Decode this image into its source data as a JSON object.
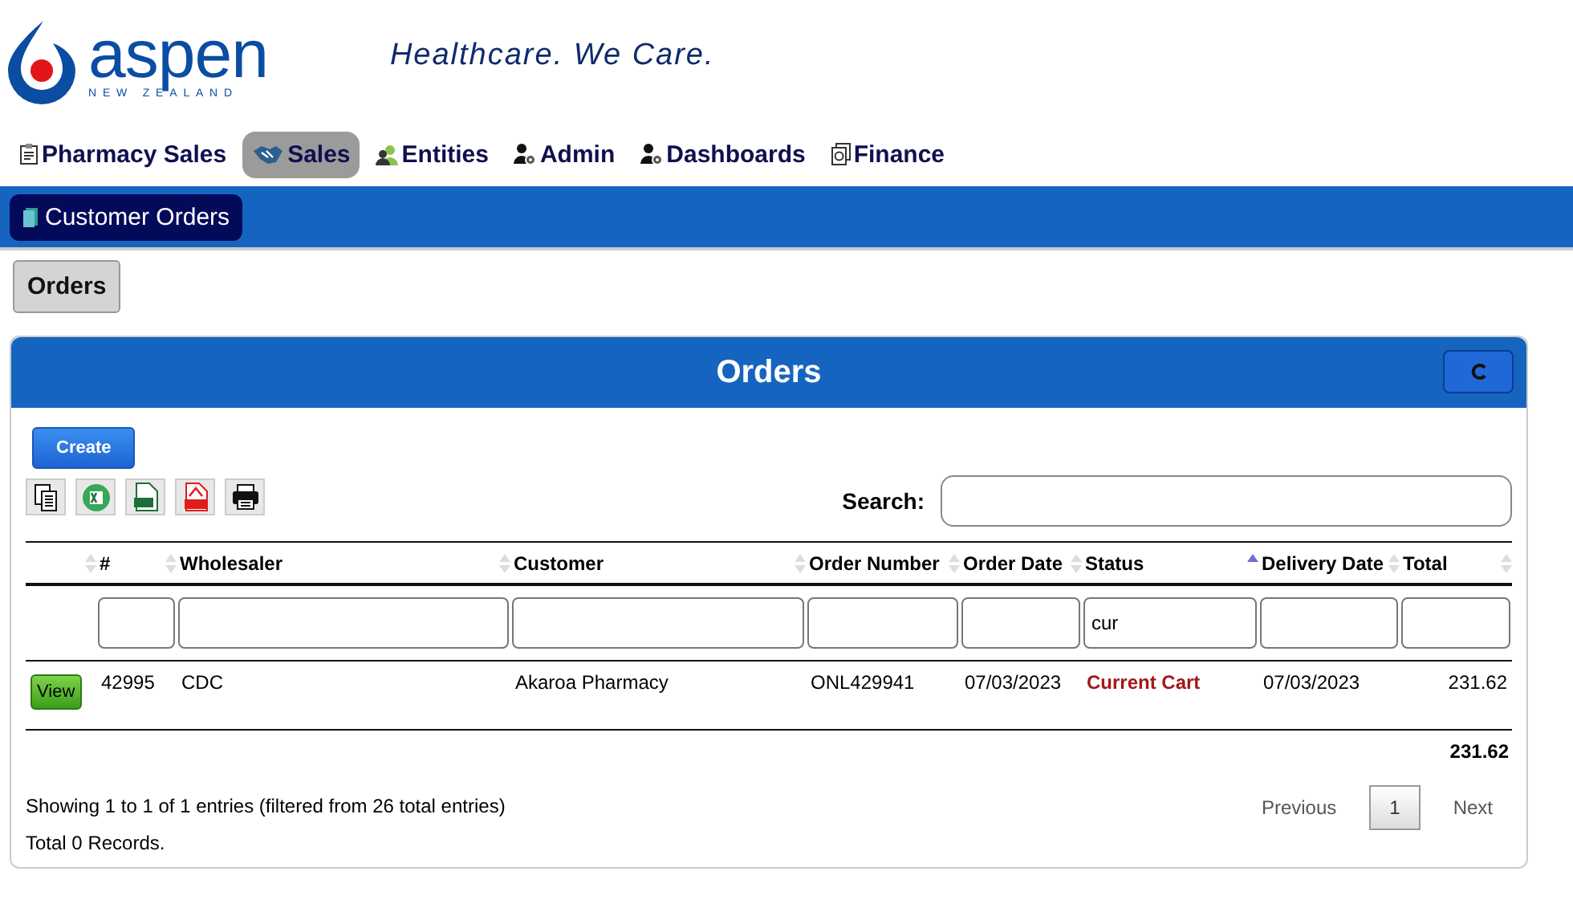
{
  "logo": {
    "wordmark": "aspen",
    "region": "NEW ZEALAND"
  },
  "tagline": "Healthcare. We Care.",
  "nav": [
    {
      "label": "Pharmacy Sales",
      "selected": false
    },
    {
      "label": "Sales",
      "selected": true
    },
    {
      "label": "Entities",
      "selected": false
    },
    {
      "label": "Admin",
      "selected": false
    },
    {
      "label": "Dashboards",
      "selected": false
    },
    {
      "label": "Finance",
      "selected": false
    }
  ],
  "subnav": [
    {
      "label": "Customer Orders",
      "selected": true
    }
  ],
  "section_button": "Orders",
  "panel": {
    "title": "Orders",
    "create_button": "Create",
    "export_buttons": [
      {
        "kind": "copy"
      },
      {
        "kind": "excel"
      },
      {
        "kind": "csv"
      },
      {
        "kind": "pdf"
      },
      {
        "kind": "print"
      }
    ],
    "search_label": "Search:",
    "table": {
      "columns": [
        {
          "sorted": false
        },
        {
          "label": "#",
          "sorted": false
        },
        {
          "label": "Wholesaler",
          "sorted": false
        },
        {
          "label": "Customer",
          "sorted": false
        },
        {
          "label": "Order Number",
          "sorted": false
        },
        {
          "label": "Order Date",
          "sorted": false
        },
        {
          "label": "Status",
          "sorted": true,
          "filter": "cur"
        },
        {
          "label": "Delivery Date",
          "sorted": false
        },
        {
          "label": "Total",
          "sorted": false
        }
      ],
      "rows": [
        {
          "cells": [
            "View",
            "42995",
            "CDC",
            "Akaroa Pharmacy",
            "ONL429941",
            "07/03/2023",
            "Current Cart",
            "07/03/2023",
            "231.62"
          ]
        }
      ],
      "footer_total": "231.62"
    },
    "info": "Showing 1 to 1 of 1 entries (filtered from 26 total entries)",
    "records": "Total 0 Records.",
    "pagination": {
      "previous": "Previous",
      "pages": [
        {
          "label": "1",
          "selected": true
        }
      ],
      "next": "Next"
    }
  }
}
